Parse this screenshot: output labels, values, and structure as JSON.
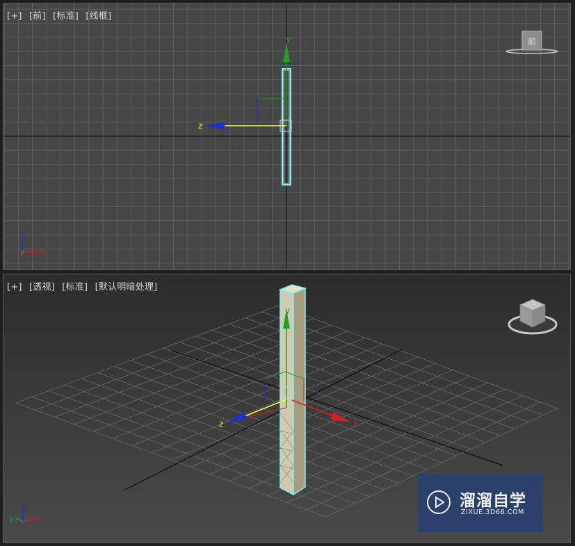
{
  "front_viewport": {
    "label_plus": "[+]",
    "label_view": "[前]",
    "label_shading": "[标准]",
    "label_mode": "[线框]",
    "viewcube_face": "前",
    "gizmo_axes": {
      "y": "y",
      "z": "z"
    },
    "corner_axes": {
      "z": "z",
      "y": "y",
      "x": "x"
    }
  },
  "persp_viewport": {
    "label_plus": "[+]",
    "label_view": "[透视]",
    "label_shading": "[标准]",
    "label_mode": "[默认明暗处理]",
    "gizmo_axes": {
      "y": "y",
      "z": "z",
      "x": "x"
    },
    "corner_axes": {
      "z": "z",
      "y": "y",
      "x": "x"
    }
  },
  "watermark": {
    "title": "溜溜自学",
    "url": "ZIXUE.3D66.COM"
  },
  "colors": {
    "x_axis": "#d42020",
    "y_axis": "#22a022",
    "z_axis": "#1a2fd6",
    "selection": "#7cf4f4",
    "active_axis": "#ffff30",
    "column_face": "#c9c0a4"
  }
}
